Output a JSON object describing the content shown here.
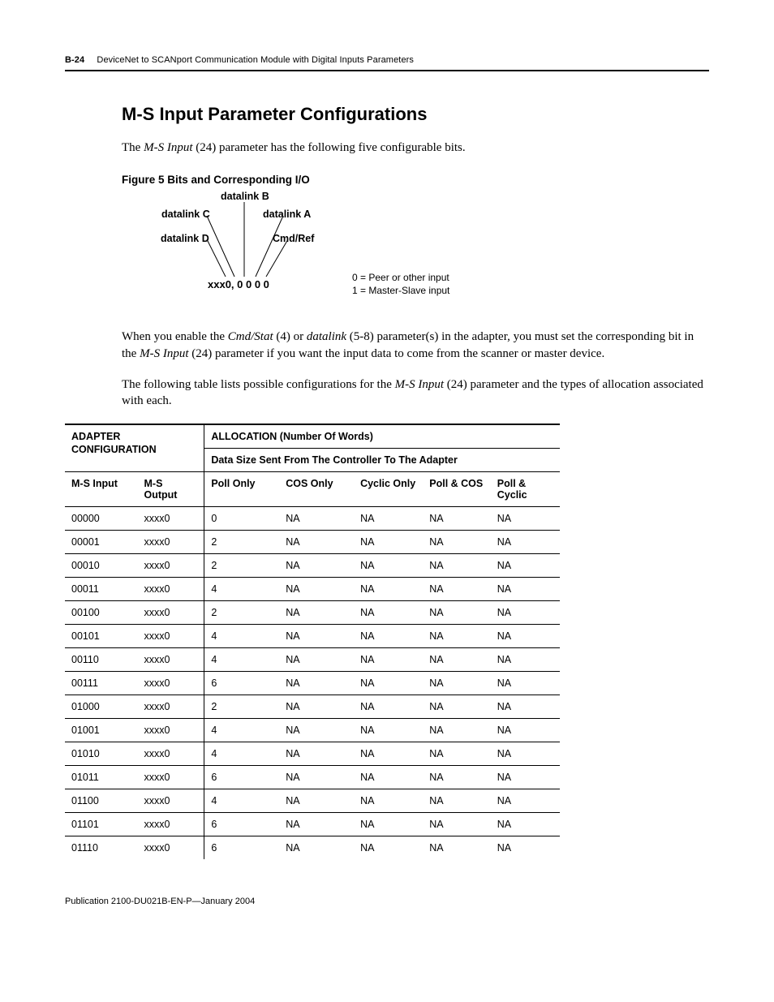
{
  "header": {
    "page_number": "B-24",
    "running_title": "DeviceNet to SCANport Communication Module with Digital Inputs Parameters"
  },
  "section": {
    "title": "M-S Input Parameter Configurations",
    "intro_pre": "The ",
    "intro_em": "M-S Input",
    "intro_post": " (24) parameter has the following five configurable bits."
  },
  "figure": {
    "caption": "Figure 5 Bits and Corresponding I/O",
    "labels": {
      "datalink_b": "datalink B",
      "datalink_c": "datalink C",
      "datalink_a": "datalink A",
      "datalink_d": "datalink D",
      "cmd_ref": "Cmd/Ref",
      "bits": "xxx0, 0 0 0 0"
    },
    "legend": {
      "zero": "0 = Peer or other input",
      "one": "1 = Master-Slave input"
    }
  },
  "paragraphs": {
    "p2a": "When you enable the ",
    "p2b": "Cmd/Stat",
    "p2c": " (4) or ",
    "p2d": "datalink",
    "p2e": " (5-8) parameter(s) in the adapter, you must set the corresponding bit in the ",
    "p2f": "M-S Input",
    "p2g": " (24) parameter if you want the input data to come from the scanner or master device.",
    "p3a": "The following table lists possible configurations for the ",
    "p3b": "M-S Input",
    "p3c": " (24) parameter and the types of allocation associated with each."
  },
  "table": {
    "group_headers": {
      "adapter_cfg": "ADAPTER CONFIGURATION",
      "allocation": "ALLOCATION (Number Of Words)",
      "data_size": "Data Size Sent From The Controller To The Adapter"
    },
    "col_headers": {
      "ms_input": "M-S Input",
      "ms_output": "M-S Output",
      "poll_only": "Poll Only",
      "cos_only": "COS Only",
      "cyclic_only": "Cyclic Only",
      "poll_cos": "Poll & COS",
      "poll_cyclic": "Poll & Cyclic"
    },
    "rows": [
      {
        "msi": "00000",
        "mso": "xxxx0",
        "poll": "0",
        "cos": "NA",
        "cyc": "NA",
        "pc": "NA",
        "pcy": "NA"
      },
      {
        "msi": "00001",
        "mso": "xxxx0",
        "poll": "2",
        "cos": "NA",
        "cyc": "NA",
        "pc": "NA",
        "pcy": "NA"
      },
      {
        "msi": "00010",
        "mso": "xxxx0",
        "poll": "2",
        "cos": "NA",
        "cyc": "NA",
        "pc": "NA",
        "pcy": "NA"
      },
      {
        "msi": "00011",
        "mso": "xxxx0",
        "poll": "4",
        "cos": "NA",
        "cyc": "NA",
        "pc": "NA",
        "pcy": "NA"
      },
      {
        "msi": "00100",
        "mso": "xxxx0",
        "poll": "2",
        "cos": "NA",
        "cyc": "NA",
        "pc": "NA",
        "pcy": "NA"
      },
      {
        "msi": "00101",
        "mso": "xxxx0",
        "poll": "4",
        "cos": "NA",
        "cyc": "NA",
        "pc": "NA",
        "pcy": "NA"
      },
      {
        "msi": "00110",
        "mso": "xxxx0",
        "poll": "4",
        "cos": "NA",
        "cyc": "NA",
        "pc": "NA",
        "pcy": "NA"
      },
      {
        "msi": "00111",
        "mso": "xxxx0",
        "poll": "6",
        "cos": "NA",
        "cyc": "NA",
        "pc": "NA",
        "pcy": "NA"
      },
      {
        "msi": "01000",
        "mso": "xxxx0",
        "poll": "2",
        "cos": "NA",
        "cyc": "NA",
        "pc": "NA",
        "pcy": "NA"
      },
      {
        "msi": "01001",
        "mso": "xxxx0",
        "poll": "4",
        "cos": "NA",
        "cyc": "NA",
        "pc": "NA",
        "pcy": "NA"
      },
      {
        "msi": "01010",
        "mso": "xxxx0",
        "poll": "4",
        "cos": "NA",
        "cyc": "NA",
        "pc": "NA",
        "pcy": "NA"
      },
      {
        "msi": "01011",
        "mso": "xxxx0",
        "poll": "6",
        "cos": "NA",
        "cyc": "NA",
        "pc": "NA",
        "pcy": "NA"
      },
      {
        "msi": "01100",
        "mso": "xxxx0",
        "poll": "4",
        "cos": "NA",
        "cyc": "NA",
        "pc": "NA",
        "pcy": "NA"
      },
      {
        "msi": "01101",
        "mso": "xxxx0",
        "poll": "6",
        "cos": "NA",
        "cyc": "NA",
        "pc": "NA",
        "pcy": "NA"
      },
      {
        "msi": "01110",
        "mso": "xxxx0",
        "poll": "6",
        "cos": "NA",
        "cyc": "NA",
        "pc": "NA",
        "pcy": "NA"
      }
    ]
  },
  "footer": {
    "publication": "Publication 2100-DU021B-EN-P—January 2004"
  }
}
